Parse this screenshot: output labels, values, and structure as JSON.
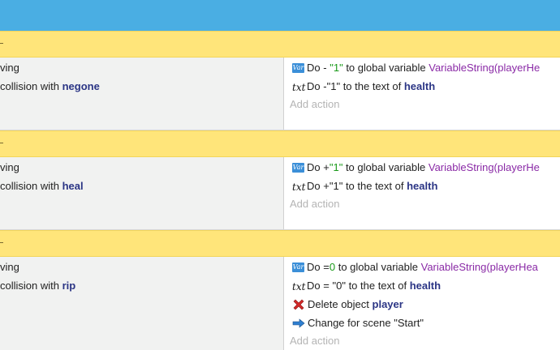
{
  "groups": [
    {
      "conditions": [
        "ving",
        "collision with"
      ],
      "collision_object": "negone",
      "actions": {
        "a1": {
          "icon": "variable-icon",
          "icon_text": "Var",
          "do": "Do",
          "op": "-",
          "value": "\"1\"",
          "middle": "to global variable",
          "variable": "VariableString(playerHe"
        },
        "a2": {
          "icon": "text-icon",
          "icon_text": "txt",
          "do": "Do",
          "op": "-",
          "value": "\"1\"",
          "middle": "to the text of",
          "object": "health"
        },
        "add_action": "Add action"
      }
    },
    {
      "conditions": [
        "ving",
        "collision with"
      ],
      "collision_object": "heal",
      "actions": {
        "a1": {
          "icon": "variable-icon",
          "icon_text": "Var",
          "do": "Do",
          "op": "+",
          "value": "\"1\"",
          "middle": "to global variable",
          "variable": "VariableString(playerHe"
        },
        "a2": {
          "icon": "text-icon",
          "icon_text": "txt",
          "do": "Do",
          "op": "+",
          "value": "\"1\"",
          "middle": "to the text of",
          "object": "health"
        },
        "add_action": "Add action"
      }
    },
    {
      "conditions": [
        "ving",
        "collision with"
      ],
      "collision_object": "rip",
      "actions": {
        "a1": {
          "icon": "variable-icon",
          "icon_text": "Var",
          "do": "Do",
          "op": "=",
          "value": "0",
          "middle": "to global variable",
          "variable": "VariableString(playerHea"
        },
        "a2": {
          "icon": "text-icon",
          "icon_text": "txt",
          "do": "Do",
          "op": "=",
          "value": "\"0\"",
          "middle": "to the text of",
          "object": "health"
        },
        "a3": {
          "icon": "delete-x-icon",
          "label": "Delete object",
          "object": "player"
        },
        "a4": {
          "icon": "arrow-right-icon",
          "label": "Change for scene",
          "scene": "\"Start\""
        },
        "add_action": "Add action"
      }
    }
  ],
  "colors": {
    "top_bar": "#4aaee3",
    "group_header": "#ffe57a",
    "conditions_bg": "#f1f2f1",
    "object_name": "#2b3585",
    "value_green": "#1a9a1a",
    "variable_purple": "#8a2aa6",
    "add_action": "#b4b4b4",
    "delete_icon": "#d42a2a",
    "arrow_icon": "#2f7fd0"
  }
}
